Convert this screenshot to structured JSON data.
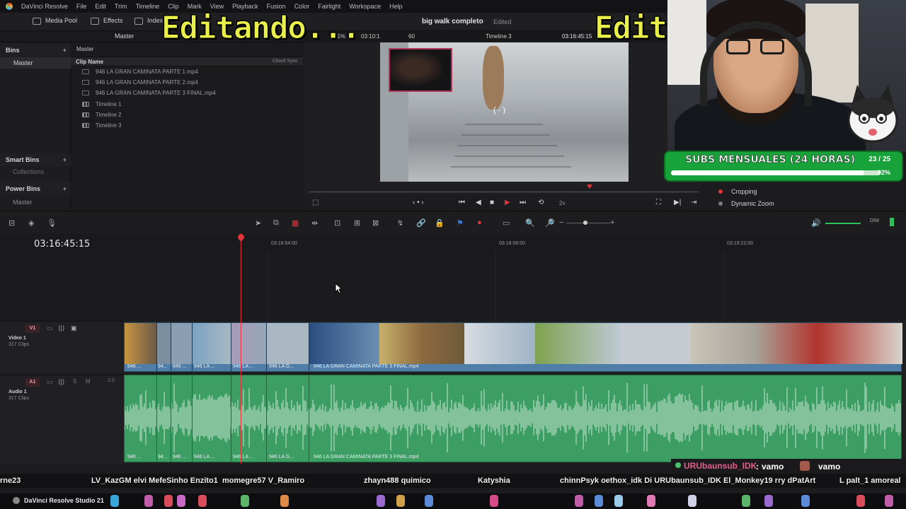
{
  "window": {
    "title": "big walk completo",
    "status": "Edited"
  },
  "menu": [
    "DaVinci Resolve",
    "File",
    "Edit",
    "Trim",
    "Timeline",
    "Clip",
    "Mark",
    "View",
    "Playback",
    "Fusion",
    "Color",
    "Fairlight",
    "Workspace",
    "Help"
  ],
  "toolbar": {
    "media_pool": "Media Pool",
    "effects": "Effects",
    "index": "Index",
    "master": "Master"
  },
  "viewer": {
    "zoom": "41%",
    "timecode_in": "03:10:1",
    "fps": "60",
    "timeline_name": "Timeline 3",
    "timecode": "03:16:45:15",
    "speed": "2x"
  },
  "bins": {
    "title": "Bins",
    "master": "Master",
    "smart_bins": "Smart Bins",
    "collections": "Collections",
    "power_bins": "Power Bins",
    "power_master": "Master"
  },
  "cliplist": {
    "path": "Master",
    "col_name": "Clip Name",
    "col_sync": "Cloud Sync",
    "rows": [
      {
        "name": "946 LA GRAN CAMINATA PARTE 1.mp4",
        "type": "clip"
      },
      {
        "name": "946 LA GRAN CAMINATA PARTE 2.mp4",
        "type": "clip"
      },
      {
        "name": "946 LA GRAN CAMINATA PARTE 3 FINAL.mp4",
        "type": "clip"
      },
      {
        "name": "Timeline 1",
        "type": "timeline"
      },
      {
        "name": "Timeline 2",
        "type": "timeline"
      },
      {
        "name": "Timeline 3",
        "type": "timeline"
      }
    ]
  },
  "inspector": {
    "cropping": "Cropping",
    "dynamic_zoom": "Dynamic Zoom"
  },
  "overlay": {
    "text_left": "Editando...",
    "text_right": "Edit"
  },
  "subs": {
    "title": "SUBS MENSUALES (24 HORAS)",
    "count": "23 / 25",
    "percent": "92%",
    "progress": 0.92
  },
  "timeline": {
    "timecode": "03:16:45:15",
    "ruler": [
      "03:16:54:00",
      "03:18:08:00",
      "03:19:22:00"
    ],
    "v1": {
      "tag": "V1",
      "name": "Video 1",
      "clips": "317 Clips"
    },
    "a1": {
      "tag": "A1",
      "name": "Audio 1",
      "clips": "317 Clips",
      "level": "2.0",
      "s": "S",
      "m": "M"
    },
    "short_labels": [
      "946 ...",
      "94...",
      "946 ...",
      "946 LA ...",
      "946 LA ...",
      "946 LA G..."
    ],
    "main_label": "946 LA GRAN CAMINATA PARTE 3 FINAL.mp4",
    "dim": "DIM"
  },
  "chat": {
    "user": "URUbaunsub_IDK",
    "sep": ":",
    "msg": "vamo",
    "msg2": "vamo"
  },
  "names": [
    "rne23",
    "LV_KazGM elvi MefeSinho Enzito1",
    "momegre57 V_Ramiro",
    "zhayn488 quimico",
    "Katyshia",
    "chinnPsyk oethox_idk Di URUbaunsub_IDK El_Monkey19 rry dPatArt",
    "L palt_1 amoreal"
  ],
  "taskbar": {
    "title": "DaVinci Resolve Studio 21"
  }
}
